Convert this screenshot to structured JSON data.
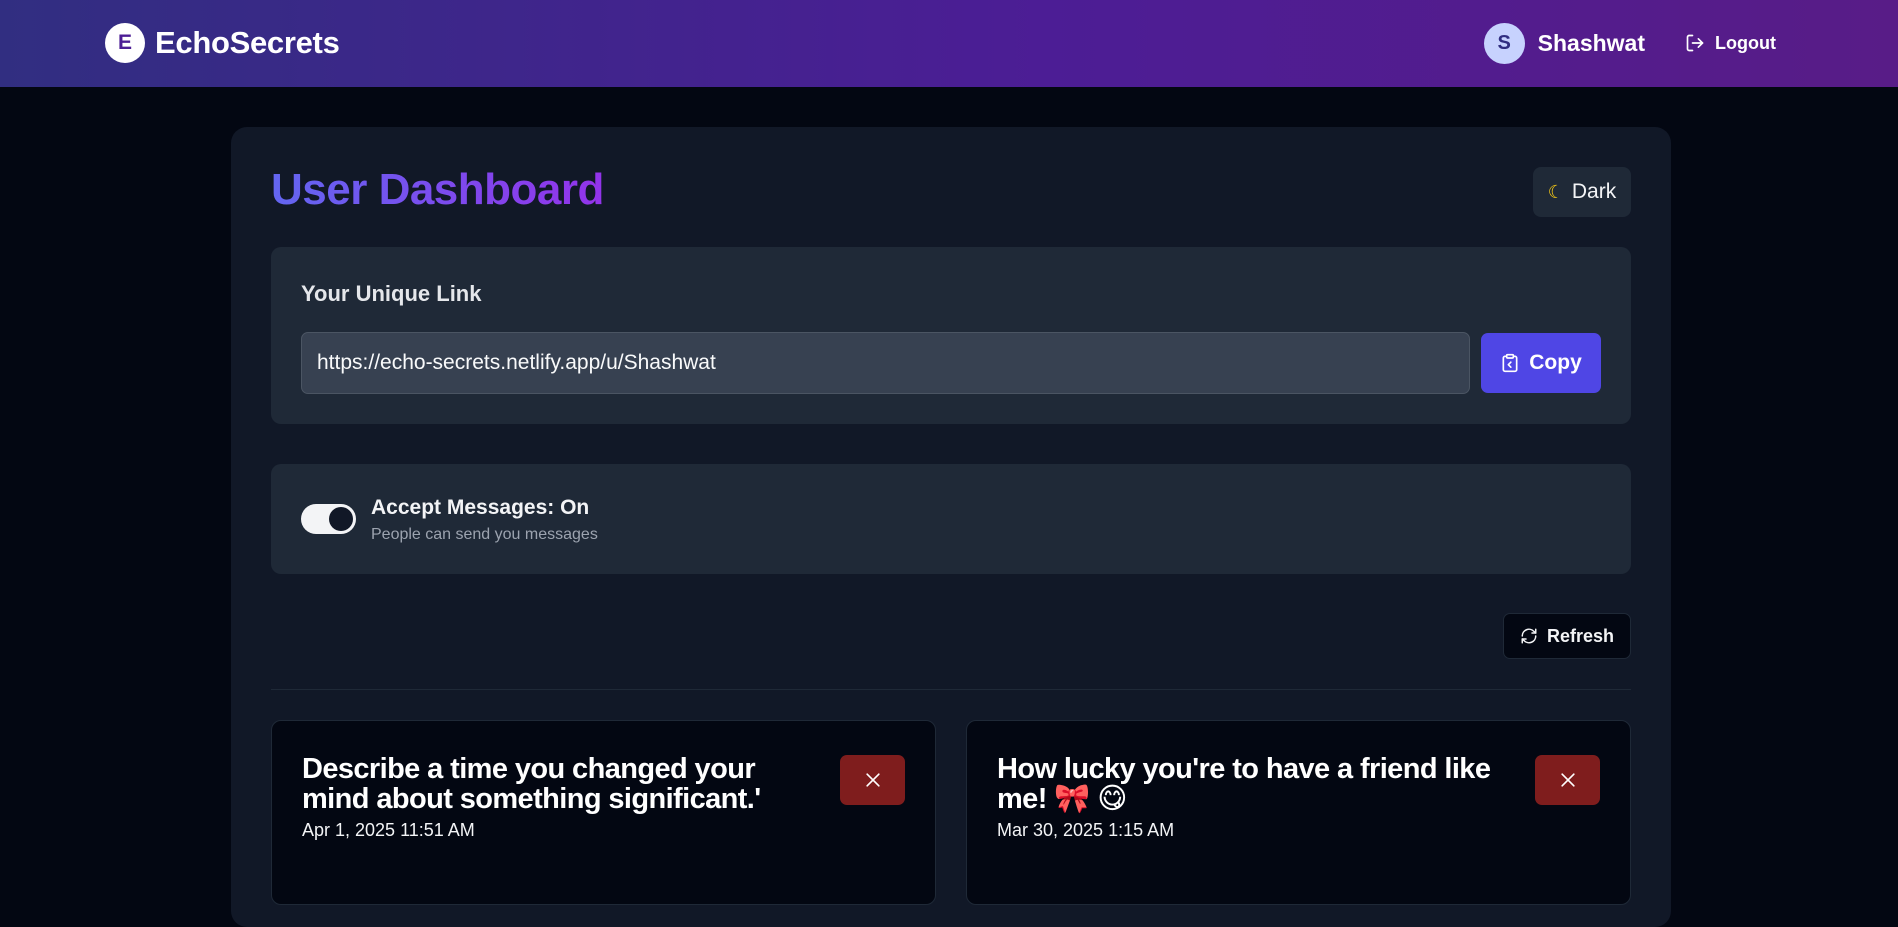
{
  "navbar": {
    "logo_letter": "E",
    "brand_name": "EchoSecrets",
    "avatar_letter": "S",
    "username": "Shashwat",
    "logout_label": "Logout"
  },
  "dashboard": {
    "title": "User Dashboard",
    "theme_toggle_label": "Dark"
  },
  "unique_link": {
    "heading": "Your Unique Link",
    "url": "https://echo-secrets.netlify.app/u/Shashwat",
    "copy_label": "Copy"
  },
  "accept_messages": {
    "enabled": true,
    "label": "Accept Messages: On",
    "description": "People can send you messages"
  },
  "refresh_label": "Refresh",
  "messages": [
    {
      "text": "Describe a time you changed your mind about something significant.'",
      "date": "Apr 1, 2025 11:51 AM"
    },
    {
      "text": "How lucky you're to have a friend like me! 🎀 😋",
      "date": "Mar 30, 2025 1:15 AM"
    }
  ],
  "colors": {
    "navbar_gradient_start": "#312e81",
    "navbar_gradient_end": "#581c87",
    "accent": "#4f46e5",
    "title_gradient_start": "#6366f1",
    "title_gradient_end": "#9333ea",
    "delete": "#7f1d1d"
  },
  "icons": {
    "logout": "logout-icon",
    "theme": "moon-icon",
    "copy": "clipboard-icon",
    "refresh": "refresh-icon",
    "delete": "close-icon"
  }
}
